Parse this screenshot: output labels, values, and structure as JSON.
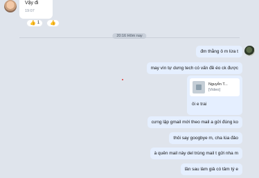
{
  "incoming": {
    "text": "Vậy đi",
    "time": "19:07",
    "reactions": [
      {
        "icon": "like-icon",
        "glyph": "👍",
        "count": "1"
      },
      {
        "icon": "like-icon",
        "glyph": "👍",
        "count": ""
      }
    ]
  },
  "divider": {
    "label": "20:16 Hôm nay"
  },
  "messages": [
    {
      "text": "đm thằng ô m lừa t"
    },
    {
      "text": "may vìn tự dưng tech có vấn đề éo ck được"
    },
    {
      "text": "cưng lập gmail mới theo mail a gửi đúng ko"
    },
    {
      "text": "thôi say googbye m, cha lúa đảo"
    },
    {
      "text": "à quên mail này del trùng mail t gửi nha m"
    },
    {
      "text": "lần sau làm giả có tâm tý e"
    }
  ],
  "file": {
    "name": "Nguyễn T...",
    "type": "[Video]",
    "caption": "ôi e trai"
  }
}
